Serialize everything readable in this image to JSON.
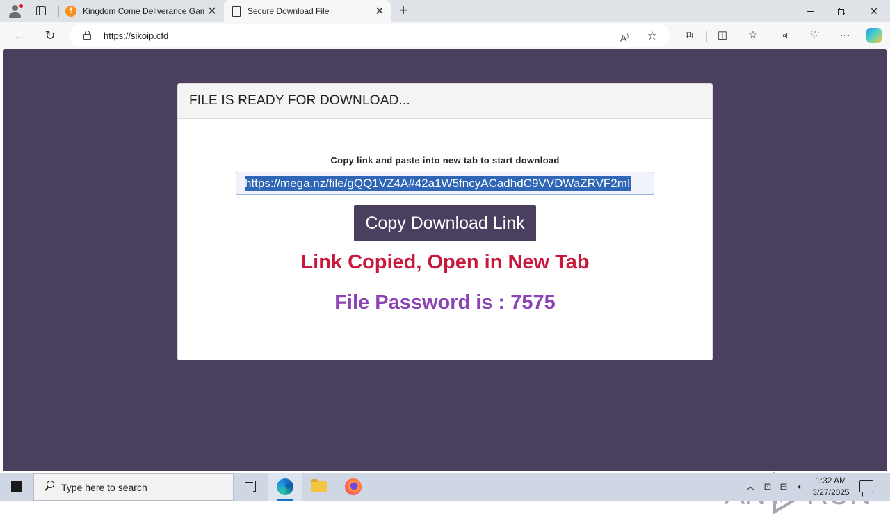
{
  "browser": {
    "tabs": [
      {
        "title": "Kingdom Come Deliverance Gam",
        "active": false
      },
      {
        "title": "Secure Download File",
        "active": true
      }
    ],
    "new_tab_symbol": "+",
    "close_symbol": "✕",
    "url": "https://sikoip.cfd",
    "icons": [
      "profile-icon",
      "tab-actions-icon",
      "back-icon",
      "refresh-icon",
      "lock-icon",
      "read-aloud-icon",
      "favorite-icon",
      "extensions-icon",
      "split-screen-icon",
      "favorites-icon",
      "collections-icon",
      "browser-essentials-icon",
      "more-icon",
      "copilot-icon"
    ]
  },
  "page": {
    "card_header": "FILE IS READY FOR DOWNLOAD...",
    "instruction": "Copy link and paste into new tab to start download",
    "link_value": "https://mega.nz/file/gQQ1VZ4A#42a1W5fncyACadhdC9VVDWaZRVF2mI",
    "copy_button_label": "Copy Download Link",
    "copied_message": "Link Copied, Open in New Tab",
    "password_message": "File Password is : 7575",
    "colors": {
      "background": "#4a3f5e",
      "copied": "#c8183b",
      "password": "#8b44b6",
      "button": "#4a3f5e"
    }
  },
  "watermark": {
    "left": "ANY",
    "right": "RUN"
  },
  "taskbar": {
    "search_placeholder": "Type here to search",
    "time": "1:32 AM",
    "date": "3/27/2025"
  }
}
